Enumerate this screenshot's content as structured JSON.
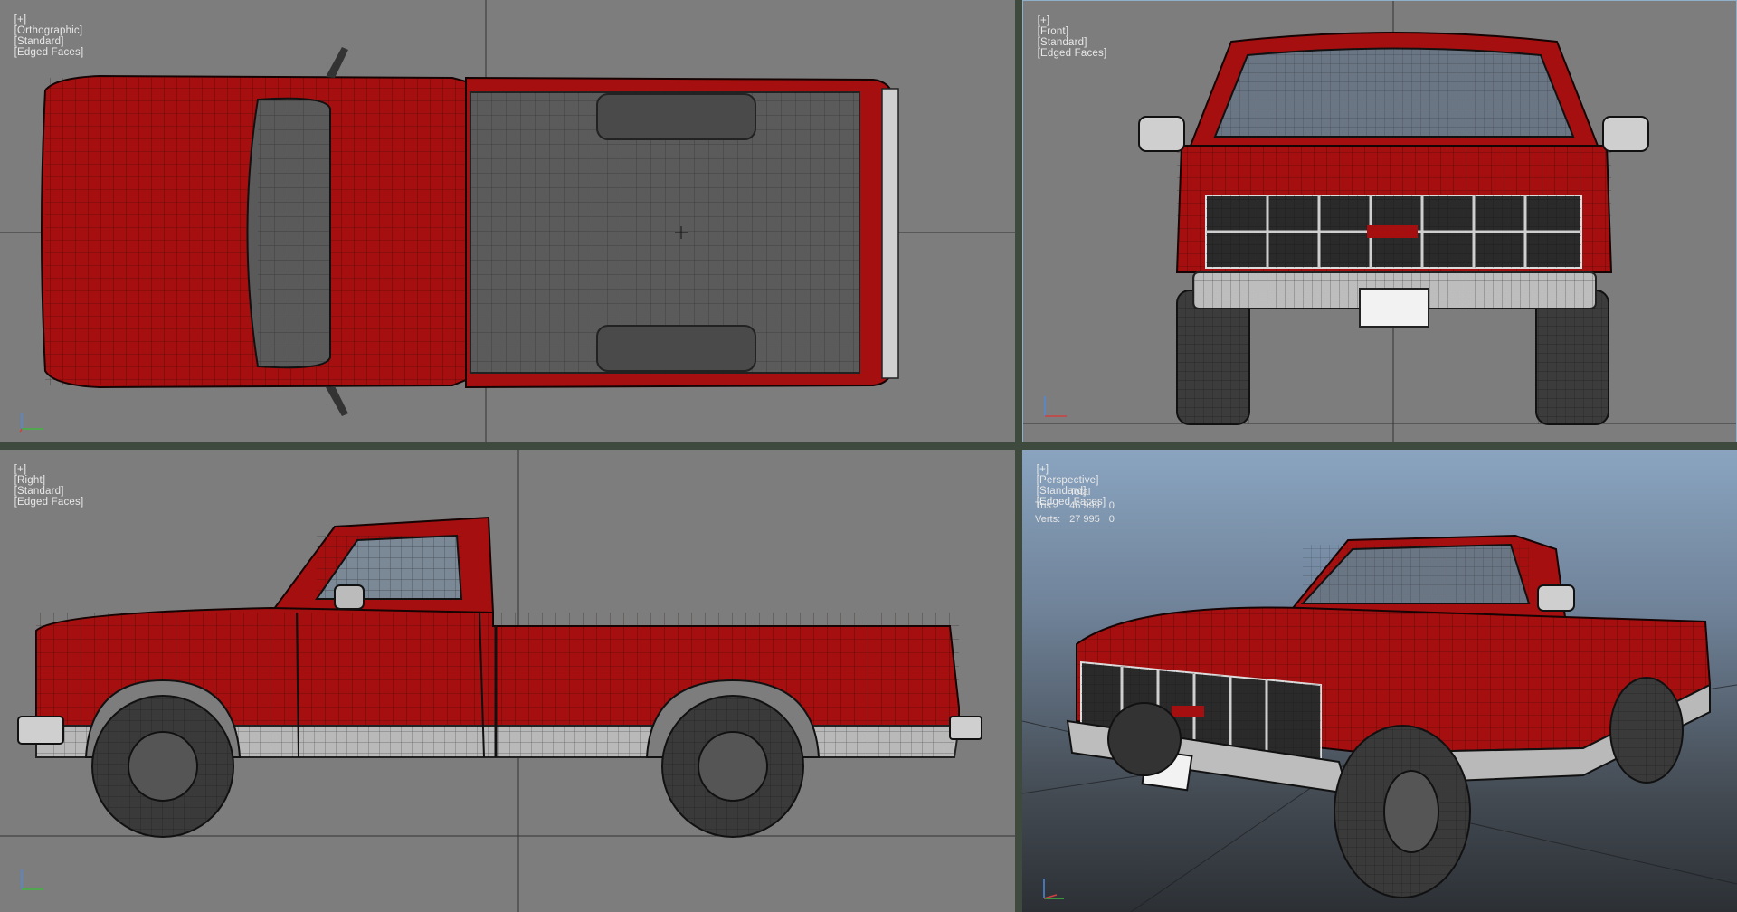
{
  "viewports": {
    "top": {
      "label_plus": "[+]",
      "label_view": "[Orthographic]",
      "label_shading": "[Standard]",
      "label_mode": "[Edged Faces]"
    },
    "front": {
      "label_plus": "[+]",
      "label_view": "[Front]",
      "label_shading": "[Standard]",
      "label_mode": "[Edged Faces]"
    },
    "right": {
      "label_plus": "[+]",
      "label_view": "[Right]",
      "label_shading": "[Standard]",
      "label_mode": "[Edged Faces]"
    },
    "perspective": {
      "label_plus": "[+]",
      "label_view": "[Perspective]",
      "label_shading": "[Standard]",
      "label_mode": "[Edged Faces]"
    }
  },
  "stats": {
    "header": "Total",
    "rows": [
      {
        "name": "Tris:",
        "total": "46 999",
        "selected": "0"
      },
      {
        "name": "Verts:",
        "total": "27 995",
        "selected": "0"
      }
    ]
  },
  "gizmo": {
    "x": "x",
    "y": "y",
    "z": "z"
  },
  "colors": {
    "body_red": "#a60f0f",
    "viewport_bg": "#7d7d7d",
    "active_border": "#8fb0c8",
    "grid_line": "#333333"
  }
}
